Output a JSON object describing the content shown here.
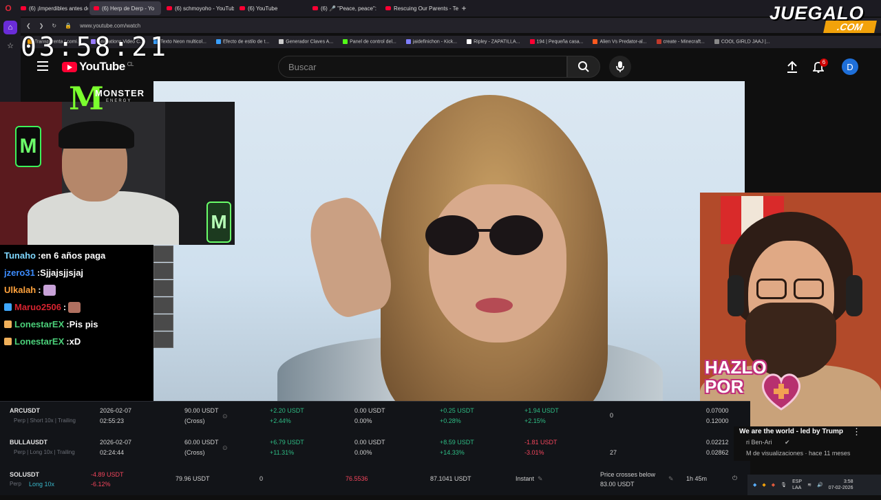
{
  "browser": {
    "tabs": [
      {
        "label": "(6) ¡Imperdibles antes de..."
      },
      {
        "label": "(6) Herp de Derp - Yo",
        "active": true
      },
      {
        "label": "(6) schmoyoho - YouTube"
      },
      {
        "label": "(6) YouTube"
      },
      {
        "label": "(6) 🎤 \"Peace, peace\":"
      },
      {
        "label": "Rescuing Our Parents - Te"
      }
    ],
    "url": "www.youtube.com/watch",
    "bookmarks": [
      {
        "label": "Transparenta / comi...",
        "color": "#f2a20a"
      },
      {
        "label": "Animations Video C...",
        "color": "#9a7cff"
      },
      {
        "label": "Texto Neon multicol...",
        "color": "#3aa0ff"
      },
      {
        "label": "Efecto de estilo de t...",
        "color": "#3aa0ff"
      },
      {
        "label": "Generador Claves A...",
        "color": "#cccccc"
      },
      {
        "label": "Panel de control del...",
        "color": "#53fc18"
      },
      {
        "label": "jaidefinichon - Kick...",
        "color": "#7f7fff"
      },
      {
        "label": "Ripley - ZAPATILLA...",
        "color": "#ffffff"
      },
      {
        "label": "194 | Pequeña casa...",
        "color": "#ff0033"
      },
      {
        "label": "Alien Vs Predator-al...",
        "color": "#ff5a1f"
      },
      {
        "label": "create - Minecraft...",
        "color": "#c0392b"
      },
      {
        "label": "COOL GIRLD JAAJ |...",
        "color": "#888888"
      }
    ]
  },
  "overlay": {
    "clock": "03:58:21",
    "juegalo_brand": "JUEGALO",
    "juegalo_suffix": ".COM",
    "monster_brand": "MONSTER",
    "monster_sub": "ENERGY",
    "hazlo_line1": "HAZLO",
    "hazlo_line2": "POR"
  },
  "youtube": {
    "logo": "YouTube",
    "country": "CL",
    "search_placeholder": "Buscar",
    "notifications": "6",
    "avatar_letter": "D",
    "card_title": "We are the world - led by Trump",
    "card_channel": "ri Ben-Ari",
    "card_meta": "M de visualizaciones · hace 11 meses"
  },
  "chat": [
    {
      "user": "Tunaho",
      "color": "#7fd8ff",
      "message": "en 6 años paga"
    },
    {
      "user": "jzero31",
      "color": "#3c8cff",
      "message": "Sjjajsjjsjaj"
    },
    {
      "user": "Ulkalah",
      "color": "#ffa23c",
      "message": "",
      "emote": "#c8a2d8"
    },
    {
      "user": "Maruo2506",
      "color": "#d6232f",
      "message": "",
      "emote": "#b07060",
      "badge": "#3fa8ff"
    },
    {
      "user": "LonestarEX",
      "color": "#4bd17a",
      "message": "Pis pis",
      "badge": "#f0b05a"
    },
    {
      "user": "LonestarEX",
      "color": "#4bd17a",
      "message": "xD",
      "badge": "#f0b05a"
    }
  ],
  "trading": {
    "rows": [
      {
        "pair": "ARCUSDT",
        "detail": "Perp | Short 10x | Trailing",
        "date": "2026-02-07",
        "time": "02:55:23",
        "margin": "90.00 USDT",
        "margin_mode": "(Cross)",
        "pnl": "+2.20 USDT",
        "pnl_pct": "+2.44%",
        "fee": "0.00 USDT",
        "fee_pct": "0.00%",
        "roi": "+0.25 USDT",
        "roi_pct": "+0.28%",
        "total": "+1.94 USDT",
        "total_pct": "+2.15%",
        "qty": "0",
        "price1": "0.07000",
        "price2": "0.12000"
      },
      {
        "pair": "BULLAUSDT",
        "detail": "Perp | Long 10x | Trailing",
        "date": "2026-02-07",
        "time": "02:24:44",
        "margin": "60.00 USDT",
        "margin_mode": "(Cross)",
        "pnl": "+6.79 USDT",
        "pnl_pct": "+11.31%",
        "fee": "0.00 USDT",
        "fee_pct": "0.00%",
        "roi": "+8.59 USDT",
        "roi_pct": "+14.33%",
        "total": "-1.81 USDT",
        "total_pct": "-3.01%",
        "qty": "27",
        "price1": "0.02212",
        "price2": "0.02862"
      }
    ],
    "last_row": {
      "pair": "SOLUSDT",
      "sub_perp": "Perp",
      "sub_long": "Long 10x",
      "pnl": "-4.89 USDT",
      "pnl_pct": "-6.12%",
      "margin": "79.96 USDT",
      "qty": "0",
      "entry": "76.5536",
      "value": "87.1041 USDT",
      "exec": "Instant",
      "cond_label": "Price crosses below",
      "cond_value": "83.00 USDT",
      "duration": "1h 45m"
    }
  },
  "taskbar": {
    "lang1": "ESP",
    "lang2": "LAA",
    "time": "3:58",
    "date": "07-02-2026"
  }
}
